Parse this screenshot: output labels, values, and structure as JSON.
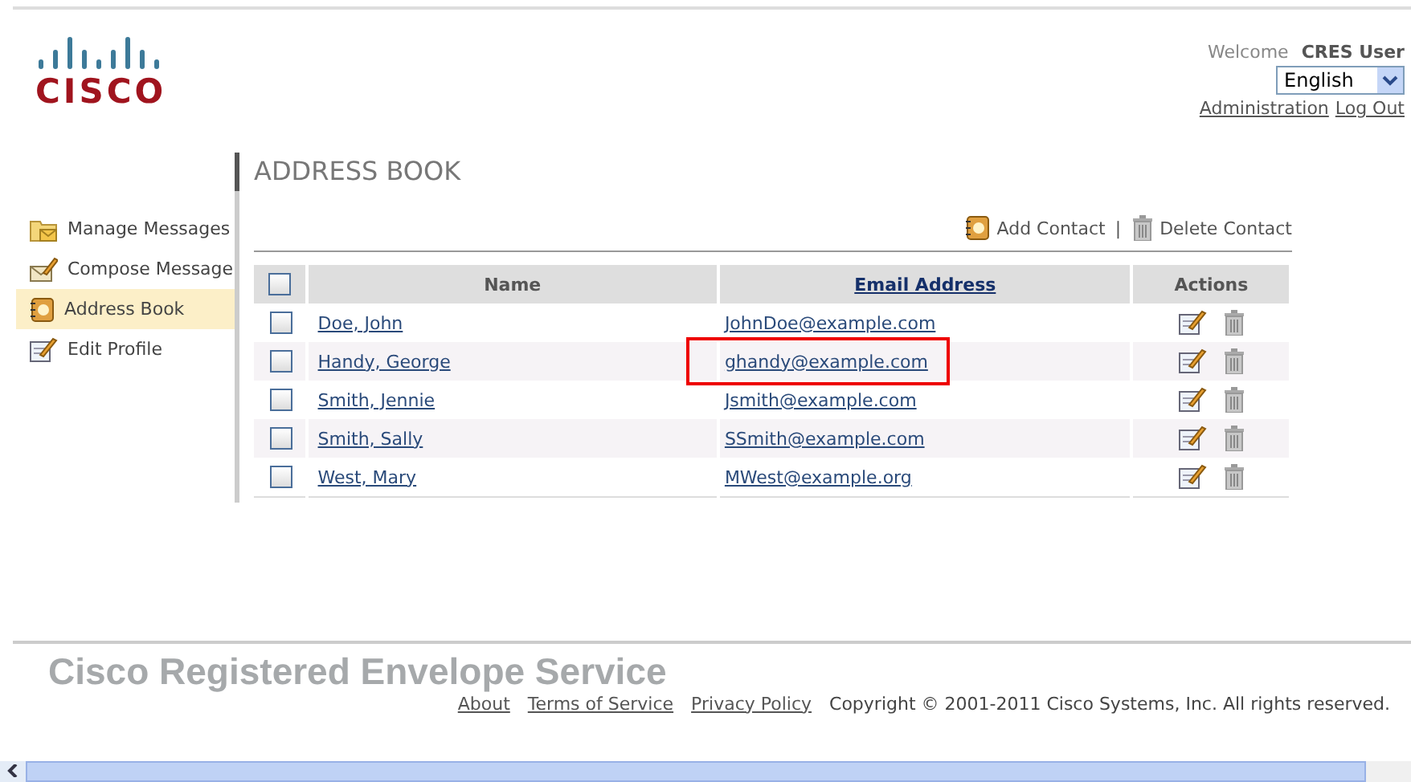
{
  "logo": {
    "wordmark": "CISCO"
  },
  "header": {
    "welcome": "Welcome",
    "user": "CRES User",
    "language": "English",
    "links": [
      "Administration",
      "Log Out"
    ]
  },
  "sidebar": {
    "items": [
      {
        "label": "Manage Messages",
        "kind": "folder",
        "selected": false
      },
      {
        "label": "Compose Message",
        "kind": "compose",
        "selected": false
      },
      {
        "label": "Address Book",
        "kind": "book",
        "selected": true
      },
      {
        "label": "Edit Profile",
        "kind": "edit",
        "selected": false
      }
    ]
  },
  "page_title": "ADDRESS BOOK",
  "toolbar": {
    "separator": "|",
    "buttons": [
      {
        "label": "Add Contact",
        "kind": "book"
      },
      {
        "label": "Delete Contact",
        "kind": "trash"
      }
    ]
  },
  "table": {
    "columns": [
      {
        "label": "Name",
        "link": false
      },
      {
        "label": "Email Address",
        "link": true
      },
      {
        "label": "Actions",
        "link": false
      }
    ],
    "select_all_checked": false,
    "rows": [
      {
        "name": "Doe, John",
        "email": "JohnDoe@example.com",
        "checked": false,
        "highlighted": false
      },
      {
        "name": "Handy, George",
        "email": "ghandy@example.com",
        "checked": false,
        "highlighted": true
      },
      {
        "name": "Smith, Jennie",
        "email": "Jsmith@example.com",
        "checked": false,
        "highlighted": false
      },
      {
        "name": "Smith, Sally",
        "email": "SSmith@example.com",
        "checked": false,
        "highlighted": false
      },
      {
        "name": "West, Mary",
        "email": "MWest@example.org",
        "checked": false,
        "highlighted": false
      }
    ]
  },
  "footer": {
    "service": "Cisco Registered Envelope Service",
    "links": [
      "About",
      "Terms of Service",
      "Privacy Policy"
    ],
    "copyright": "Copyright © 2001-2011 Cisco Systems, Inc. All rights reserved."
  }
}
